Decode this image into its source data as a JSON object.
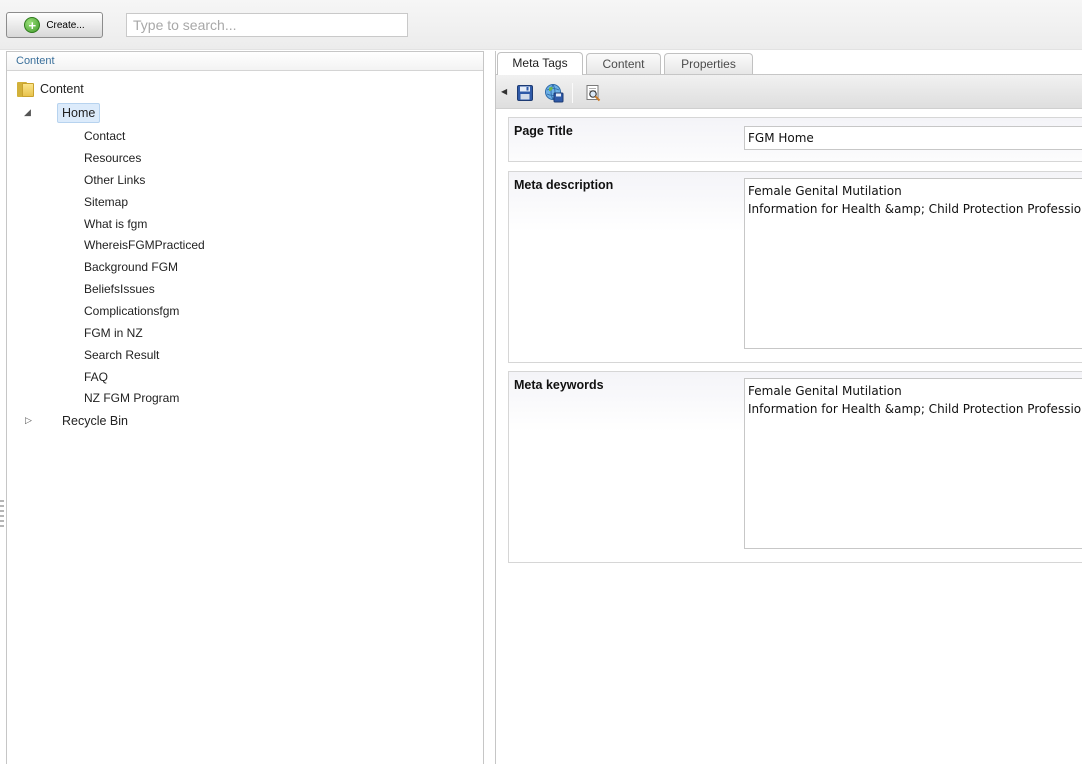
{
  "toolbar": {
    "create_label": "Create...",
    "search_placeholder": "Type to search..."
  },
  "tree": {
    "header": "Content",
    "root_label": "Content",
    "home_label": "Home",
    "children": [
      "Contact",
      "Resources",
      "Other Links",
      "Sitemap",
      "What is fgm",
      "WhereisFGMPracticed",
      "Background FGM",
      "BeliefsIssues",
      "Complicationsfgm",
      "FGM in NZ",
      "Search Result",
      "FAQ",
      "NZ FGM Program"
    ],
    "recycle_bin_label": "Recycle Bin"
  },
  "editor": {
    "tabs": [
      {
        "label": "Meta Tags",
        "active": true
      },
      {
        "label": "Content",
        "active": false
      },
      {
        "label": "Properties",
        "active": false
      }
    ],
    "fields": {
      "page_title": {
        "label": "Page Title",
        "value": "FGM Home"
      },
      "meta_description": {
        "label": "Meta description",
        "value": "Female Genital Mutilation\nInformation for Health &amp; Child Protection Professionals"
      },
      "meta_keywords": {
        "label": "Meta keywords",
        "value": "Female Genital Mutilation\nInformation for Health &amp; Child Protection Professionals"
      }
    }
  },
  "colors": {
    "header_text": "#3a6f9a",
    "selection_bg": "#dcebfb",
    "create_icon": "#3f9a2a"
  },
  "icons": {
    "create": "plus-circle-icon",
    "root": "folder-icon",
    "save": "floppy-disk-icon",
    "save_publish": "globe-save-icon",
    "preview": "magnifier-page-icon"
  }
}
